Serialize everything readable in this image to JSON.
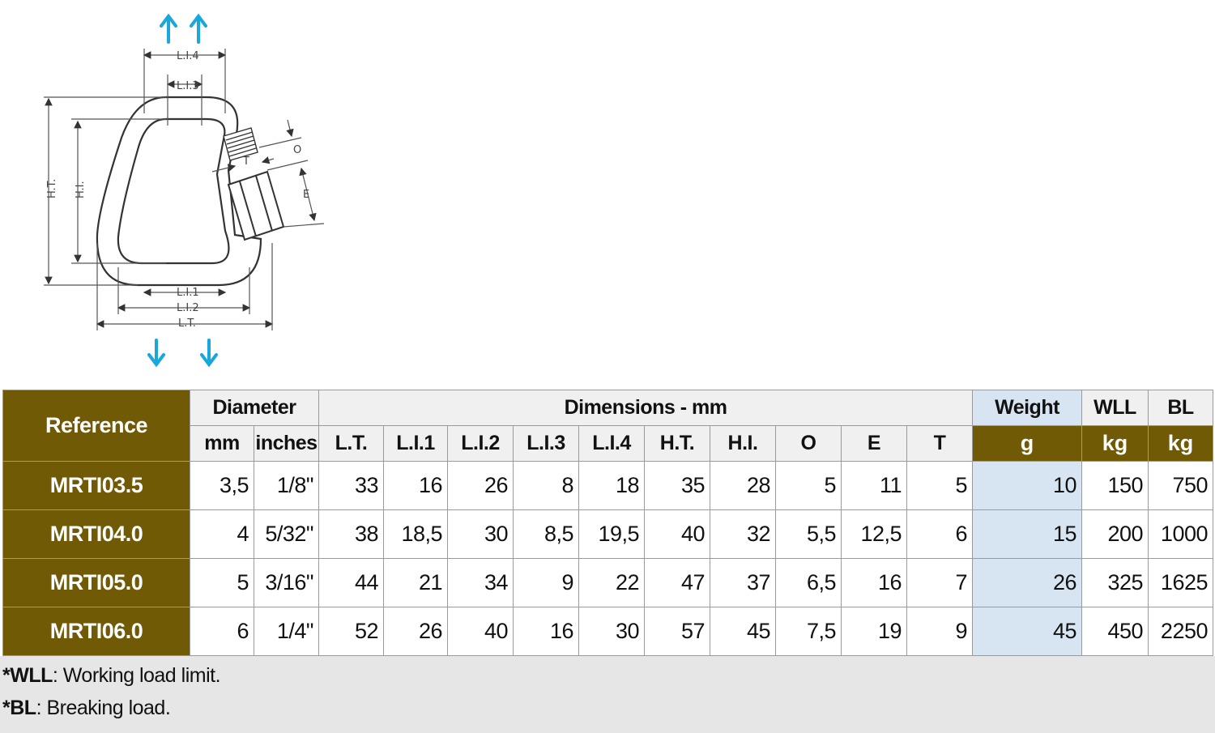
{
  "diagram": {
    "dimension_labels": {
      "li4": "L.I.4",
      "li3": "L.I.3",
      "li1": "L.I.1",
      "li2": "L.I.2",
      "lt": "L.T.",
      "ht": "H.T.",
      "hi": "H.I.",
      "o": "O",
      "t": "T",
      "e": "E"
    },
    "colors": {
      "arrow": "#19a7dc",
      "line": "#333333"
    },
    "icons": [
      "arrow-up-icon",
      "arrow-down-icon"
    ]
  },
  "table": {
    "headers": {
      "reference": "Reference",
      "diameter": "Diameter",
      "dimensions": "Dimensions - mm",
      "weight": "Weight",
      "wll": "WLL",
      "bl": "BL"
    },
    "subheaders": [
      "mm",
      "inches",
      "L.T.",
      "L.I.1",
      "L.I.2",
      "L.I.3",
      "L.I.4",
      "H.T.",
      "H.I.",
      "O",
      "E",
      "T",
      "g",
      "kg",
      "kg"
    ],
    "rows": [
      {
        "ref": "MRTI03.5",
        "cells": [
          "3,5",
          "1/8\"",
          "33",
          "16",
          "26",
          "8",
          "18",
          "35",
          "28",
          "5",
          "11",
          "5",
          "10",
          "150",
          "750"
        ]
      },
      {
        "ref": "MRTI04.0",
        "cells": [
          "4",
          "5/32\"",
          "38",
          "18,5",
          "30",
          "8,5",
          "19,5",
          "40",
          "32",
          "5,5",
          "12,5",
          "6",
          "15",
          "200",
          "1000"
        ]
      },
      {
        "ref": "MRTI05.0",
        "cells": [
          "5",
          "3/16\"",
          "44",
          "21",
          "34",
          "9",
          "22",
          "47",
          "37",
          "6,5",
          "16",
          "7",
          "26",
          "325",
          "1625"
        ]
      },
      {
        "ref": "MRTI06.0",
        "cells": [
          "6",
          "1/4\"",
          "52",
          "26",
          "40",
          "16",
          "30",
          "57",
          "45",
          "7,5",
          "19",
          "9",
          "45",
          "450",
          "2250"
        ]
      }
    ],
    "colors": {
      "brown": "#715a06",
      "light_blue": "#d7e5f2",
      "header_gray": "#f0f0f0"
    }
  },
  "footnotes": [
    {
      "abbr": "*WLL",
      "text": ": Working load limit."
    },
    {
      "abbr": "*BL",
      "text": ": Breaking load."
    }
  ]
}
